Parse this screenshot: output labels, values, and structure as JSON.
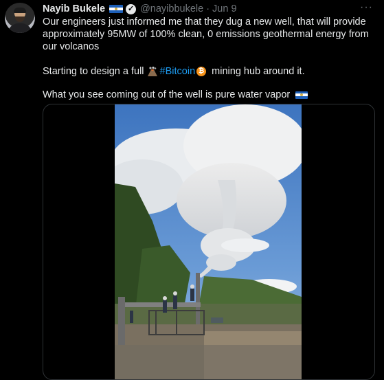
{
  "tweet": {
    "author_name": "Nayib Bukele",
    "handle": "@nayibbukele",
    "separator": "·",
    "date": "Jun 9",
    "more_label": "···",
    "paragraph1": "Our engineers just informed me that they dug a new well, that will provide approximately 95MW of 100% clean, 0 emissions geothermal energy from our volcanos",
    "paragraph2_before": "Starting to design a full",
    "hashtag": "#Bitcoin",
    "paragraph2_after": "mining hub around it.",
    "paragraph3": "What you see coming out of the well is pure water vapor"
  },
  "icons": {
    "flag": "el-salvador-flag-icon",
    "verified": "verified-badge-icon",
    "volcano": "volcano-icon",
    "bitcoin": "bitcoin-icon",
    "more": "more-options-icon"
  },
  "colors": {
    "background": "#000000",
    "text": "#e7e9ea",
    "secondary": "#71767b",
    "link": "#1d9bf0",
    "border": "#2f3336"
  }
}
